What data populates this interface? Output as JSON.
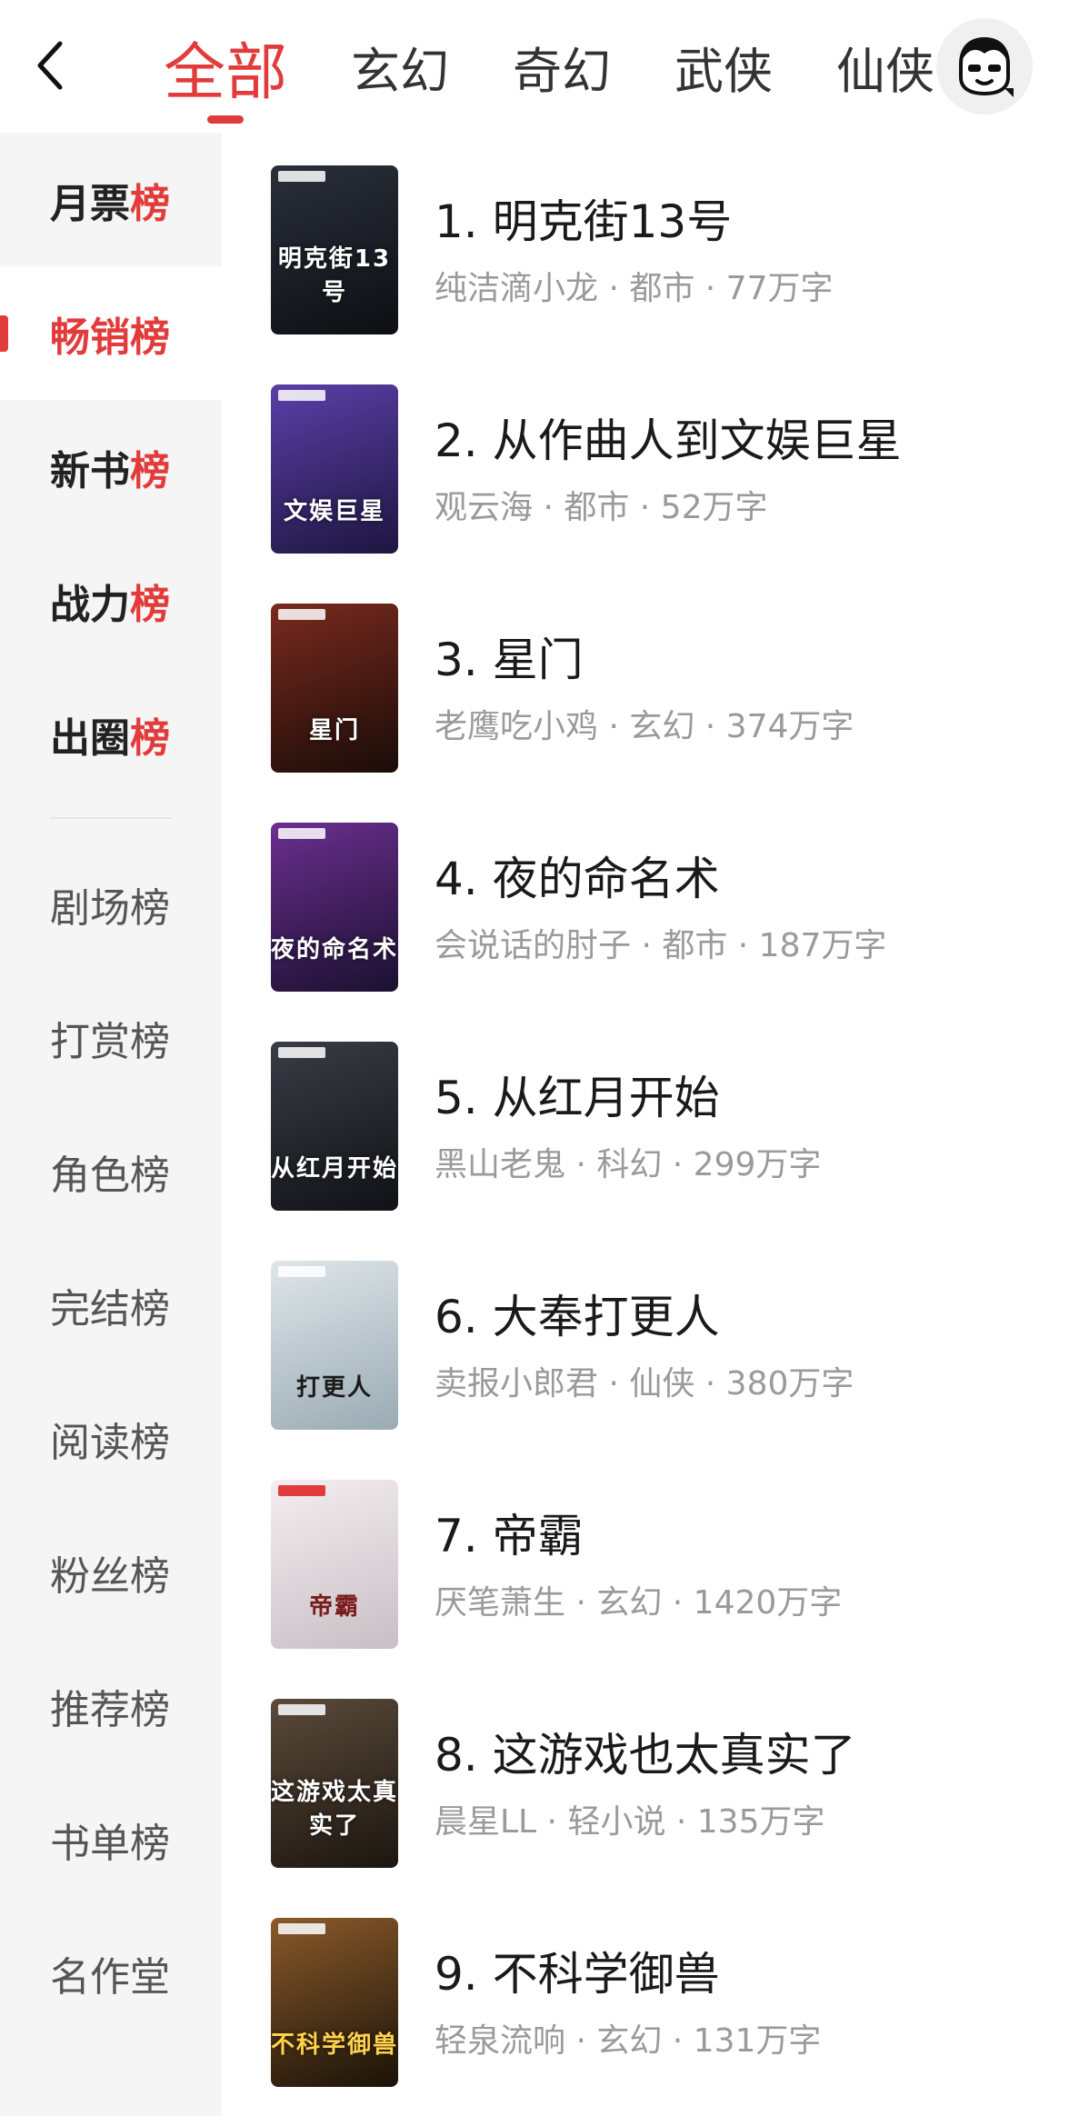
{
  "header": {
    "tabs": [
      "全部",
      "玄幻",
      "奇幻",
      "武侠",
      "仙侠"
    ],
    "active_tab": 0
  },
  "sidebar": {
    "ranks_primary": [
      {
        "prefix": "月票",
        "accent": "榜"
      },
      {
        "prefix": "畅销",
        "accent": "榜"
      },
      {
        "prefix": "新书",
        "accent": "榜"
      },
      {
        "prefix": "战力",
        "accent": "榜"
      },
      {
        "prefix": "出圈",
        "accent": "榜"
      }
    ],
    "active_index": 1,
    "ranks_secondary": [
      "剧场榜",
      "打赏榜",
      "角色榜",
      "完结榜",
      "阅读榜",
      "粉丝榜",
      "推荐榜",
      "书单榜",
      "名作堂"
    ]
  },
  "books": [
    {
      "title": "1. 明克街13号",
      "meta": "纯洁滴小龙 · 都市 · 77万字",
      "cover_text": "明克街13号",
      "cover_colors": [
        "#2a2f3a",
        "#0d0f14"
      ]
    },
    {
      "title": "2. 从作曲人到文娱巨星",
      "meta": "观云海 · 都市 · 52万字",
      "cover_text": "文娱巨星",
      "cover_colors": [
        "#5b3fa8",
        "#1d1640"
      ]
    },
    {
      "title": "3. 星门",
      "meta": "老鹰吃小鸡 · 玄幻 · 374万字",
      "cover_text": "星门",
      "cover_colors": [
        "#7a2a1e",
        "#1a0c08"
      ]
    },
    {
      "title": "4. 夜的命名术",
      "meta": "会说话的肘子 · 都市 · 187万字",
      "cover_text": "夜的命名术",
      "cover_colors": [
        "#6b2f8f",
        "#1b1030"
      ]
    },
    {
      "title": "5. 从红月开始",
      "meta": "黑山老鬼 · 科幻 · 299万字",
      "cover_text": "从红月开始",
      "cover_colors": [
        "#3a3c46",
        "#111216"
      ]
    },
    {
      "title": "6. 大奉打更人",
      "meta": "卖报小郎君 · 仙侠 · 380万字",
      "cover_text": "打更人",
      "cover_colors": [
        "#dfe6ea",
        "#9aaab3"
      ]
    },
    {
      "title": "7. 帝霸",
      "meta": "厌笔萧生 · 玄幻 · 1420万字",
      "cover_text": "帝霸",
      "cover_colors": [
        "#f3eef0",
        "#c9bfc4"
      ]
    },
    {
      "title": "8. 这游戏也太真实了",
      "meta": "晨星LL · 轻小说 · 135万字",
      "cover_text": "这游戏太真实了",
      "cover_colors": [
        "#5a4a3a",
        "#1c1610"
      ]
    },
    {
      "title": "9. 不科学御兽",
      "meta": "轻泉流响 · 玄幻 · 131万字",
      "cover_text": "不科学御兽",
      "cover_colors": [
        "#8a5a2a",
        "#1a1208"
      ]
    }
  ],
  "colors": {
    "accent": "#e23b3b",
    "sidebar_bg": "#f5f5f5",
    "meta_text": "#9a9a9a"
  }
}
